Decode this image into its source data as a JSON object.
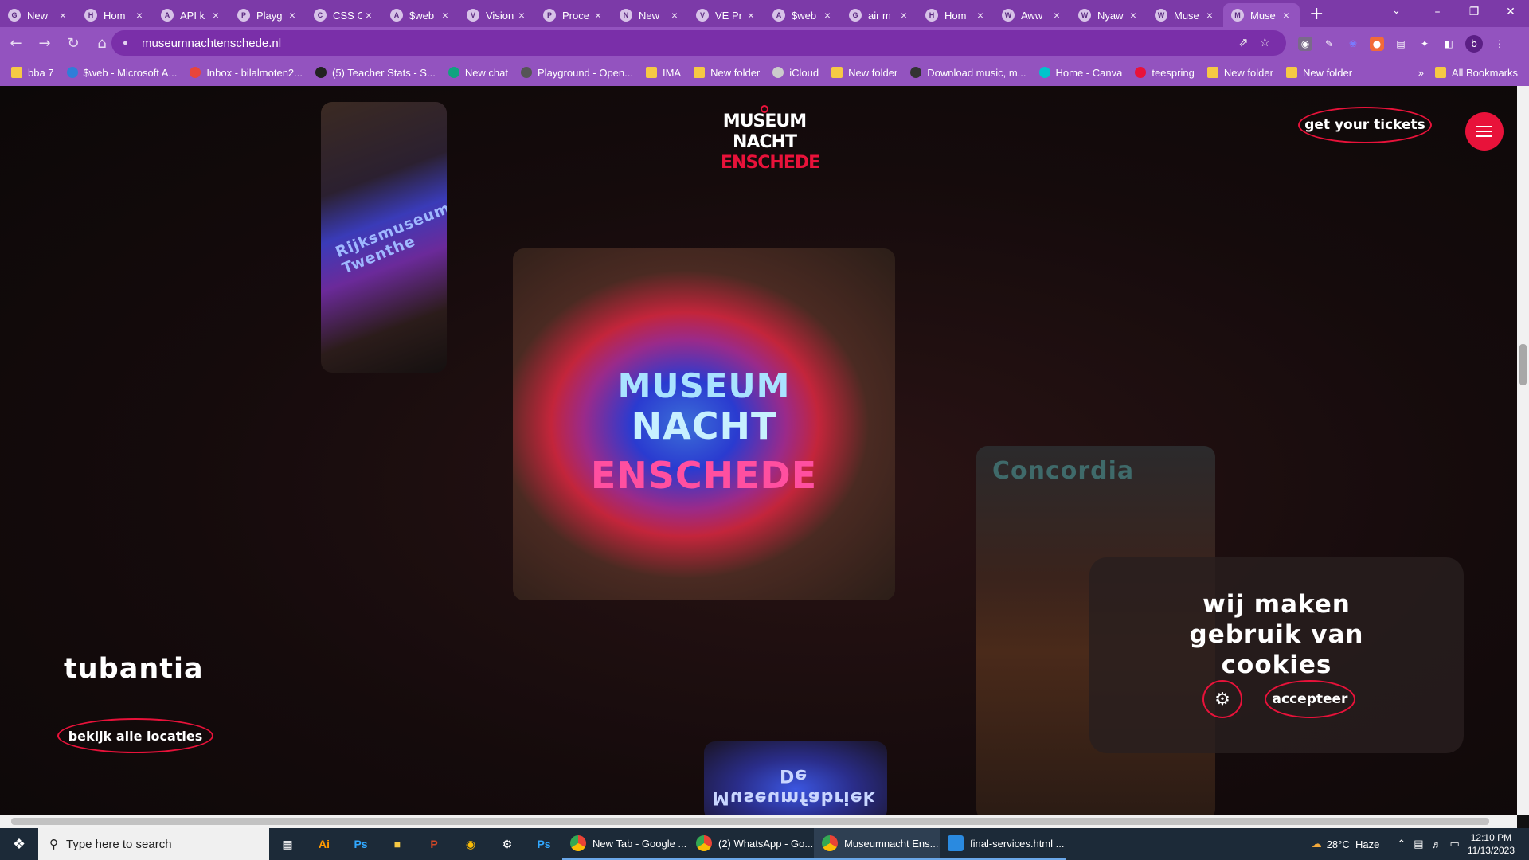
{
  "browser": {
    "tabs": [
      {
        "label": "New",
        "icon": "G"
      },
      {
        "label": "Hom",
        "icon": "H"
      },
      {
        "label": "API k",
        "icon": "A"
      },
      {
        "label": "Playg",
        "icon": "P"
      },
      {
        "label": "CSS C",
        "icon": "C"
      },
      {
        "label": "$web",
        "icon": "A"
      },
      {
        "label": "Vision",
        "icon": "V"
      },
      {
        "label": "Proce",
        "icon": "P"
      },
      {
        "label": "New",
        "icon": "N"
      },
      {
        "label": "VE Pr",
        "icon": "V"
      },
      {
        "label": "$web",
        "icon": "A"
      },
      {
        "label": "air m",
        "icon": "G"
      },
      {
        "label": "Hom",
        "icon": "H"
      },
      {
        "label": "Aww",
        "icon": "W"
      },
      {
        "label": "Nyaw",
        "icon": "W"
      },
      {
        "label": "Muse",
        "icon": "W"
      },
      {
        "label": "Muse",
        "icon": "M"
      }
    ],
    "new_tab": "+",
    "url": "museumnachtenschede.nl",
    "profile_initial": "b",
    "bookmarks": [
      {
        "label": "bba 7",
        "type": "folder"
      },
      {
        "label": "$web - Microsoft A...",
        "type": "site"
      },
      {
        "label": "Inbox - bilalmoten2...",
        "type": "site"
      },
      {
        "label": "(5) Teacher Stats - S...",
        "type": "site"
      },
      {
        "label": "New chat",
        "type": "site"
      },
      {
        "label": "Playground - Open...",
        "type": "site"
      },
      {
        "label": "IMA",
        "type": "folder"
      },
      {
        "label": "New folder",
        "type": "folder"
      },
      {
        "label": "iCloud",
        "type": "site"
      },
      {
        "label": "New folder",
        "type": "folder"
      },
      {
        "label": "Download music, m...",
        "type": "site"
      },
      {
        "label": "Home - Canva",
        "type": "site"
      },
      {
        "label": "teespring",
        "type": "site"
      },
      {
        "label": "New folder",
        "type": "folder"
      },
      {
        "label": "New folder",
        "type": "folder"
      }
    ],
    "bookmarks_overflow": "»",
    "all_bookmarks": "All Bookmarks"
  },
  "site": {
    "logo": {
      "line1": "MUSEUM",
      "line2": "NACHT",
      "line3": "ENSCHEDE"
    },
    "tickets_label": "get your tickets",
    "location_title": "tubantia",
    "locations_button": "bekijk alle locaties",
    "projection_text": {
      "line1": "MUSEUM",
      "line2": "NACHT",
      "line3": "ENSCHEDE",
      "side": "Rijksmuseum Twenthe",
      "concordia": "Concordia",
      "fabriek_line1": "De",
      "fabriek_line2": "Museumfabriek"
    },
    "cookie": {
      "title": "wij maken gebruik van cookies",
      "accept_label": "accepteer"
    },
    "accent_color": "#e8123a"
  },
  "taskbar": {
    "search_placeholder": "Type here to search",
    "apps": [
      {
        "label": "New Tab - Google ..."
      },
      {
        "label": "(2) WhatsApp - Go..."
      },
      {
        "label": "Museumnacht Ens..."
      },
      {
        "label": "final-services.html ..."
      }
    ],
    "weather": "28°C  Haze",
    "time": "12:10 PM",
    "date": "11/13/2023"
  }
}
